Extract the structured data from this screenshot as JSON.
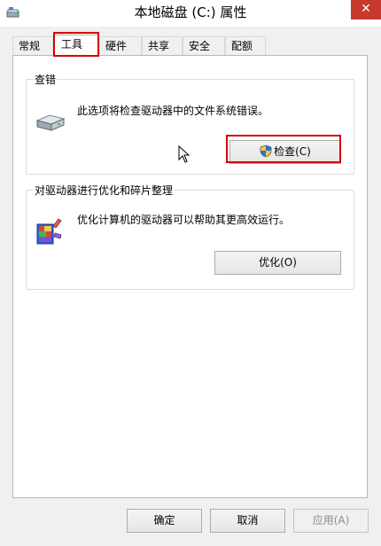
{
  "window": {
    "title": "本地磁盘 (C:) 属性",
    "close_glyph": "✕"
  },
  "tabs": [
    {
      "label": "常规"
    },
    {
      "label": "工具"
    },
    {
      "label": "硬件"
    },
    {
      "label": "共享"
    },
    {
      "label": "安全"
    },
    {
      "label": "配额"
    }
  ],
  "active_tab": "工具",
  "error_check": {
    "group_label": "查错",
    "description": "此选项将检查驱动器中的文件系统错误。",
    "button_label": "检查(C)",
    "icon": "hard-drive-icon"
  },
  "optimize": {
    "group_label": "对驱动器进行优化和碎片整理",
    "description": "优化计算机的驱动器可以帮助其更高效运行。",
    "button_label": "优化(O)",
    "icon": "defrag-icon"
  },
  "footer": {
    "ok_label": "确定",
    "cancel_label": "取消",
    "apply_label": "应用(A)"
  },
  "colors": {
    "close_button": "#c7392c",
    "highlight": "#d90000"
  }
}
